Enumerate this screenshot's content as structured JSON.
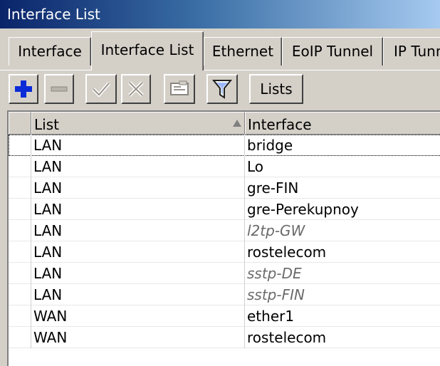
{
  "window": {
    "title": "Interface List"
  },
  "tabs": [
    {
      "label": "Interface",
      "active": false
    },
    {
      "label": "Interface List",
      "active": true
    },
    {
      "label": "Ethernet",
      "active": false
    },
    {
      "label": "EoIP Tunnel",
      "active": false
    },
    {
      "label": "IP Tunnel",
      "active": false
    }
  ],
  "toolbar": {
    "add_icon": "plus-icon",
    "remove_icon": "minus-icon",
    "enable_icon": "check-icon",
    "disable_icon": "x-icon",
    "comment_icon": "comment-icon",
    "filter_icon": "filter-icon",
    "lists_label": "Lists",
    "accent": "#0b2bd6"
  },
  "table": {
    "columns": [
      "List",
      "Interface"
    ],
    "rows": [
      {
        "list": "LAN",
        "interface": "bridge",
        "disabled": false
      },
      {
        "list": "LAN",
        "interface": "Lo",
        "disabled": false
      },
      {
        "list": "LAN",
        "interface": "gre-FIN",
        "disabled": false
      },
      {
        "list": "LAN",
        "interface": "gre-Perekupnoy",
        "disabled": false
      },
      {
        "list": "LAN",
        "interface": "l2tp-GW",
        "disabled": true
      },
      {
        "list": "LAN",
        "interface": "rostelecom",
        "disabled": false
      },
      {
        "list": "LAN",
        "interface": "sstp-DE",
        "disabled": true
      },
      {
        "list": "LAN",
        "interface": "sstp-FIN",
        "disabled": true
      },
      {
        "list": "WAN",
        "interface": "ether1",
        "disabled": false
      },
      {
        "list": "WAN",
        "interface": "rostelecom",
        "disabled": false
      }
    ]
  }
}
